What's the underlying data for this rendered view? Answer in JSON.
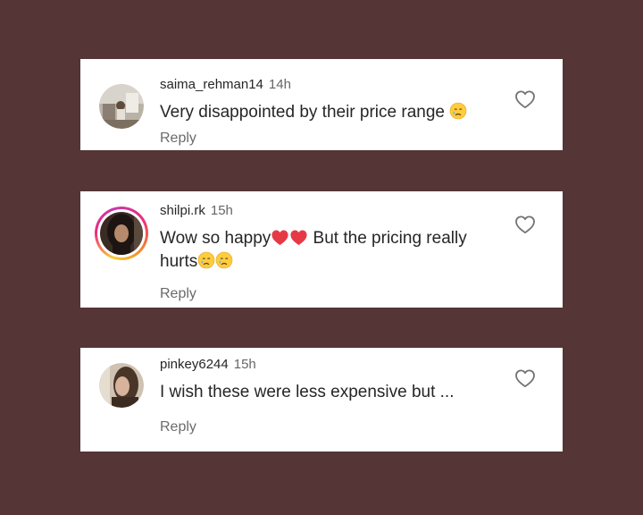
{
  "comments": [
    {
      "username": "saima_rehman14",
      "time": "14h",
      "text": "Very disappointed by their price range",
      "emojis_after": [
        "crying-face"
      ],
      "reply_label": "Reply"
    },
    {
      "username": "shilpi.rk",
      "time": "15h",
      "text_part1": "Wow so happy",
      "emojis_mid": [
        "red-heart",
        "red-heart"
      ],
      "text_part2": " But the pricing really hurts",
      "emojis_after": [
        "crying-face",
        "crying-face"
      ],
      "reply_label": "Reply",
      "avatar_has_story_ring": true
    },
    {
      "username": "pinkey6244",
      "time": "15h",
      "text": "I wish these were less expensive but ...",
      "reply_label": "Reply"
    }
  ],
  "icons": {
    "like": "heart-outline-icon"
  },
  "colors": {
    "background": "#553535",
    "card": "#ffffff",
    "text": "#262626",
    "secondary_text": "#6b6b6b"
  }
}
